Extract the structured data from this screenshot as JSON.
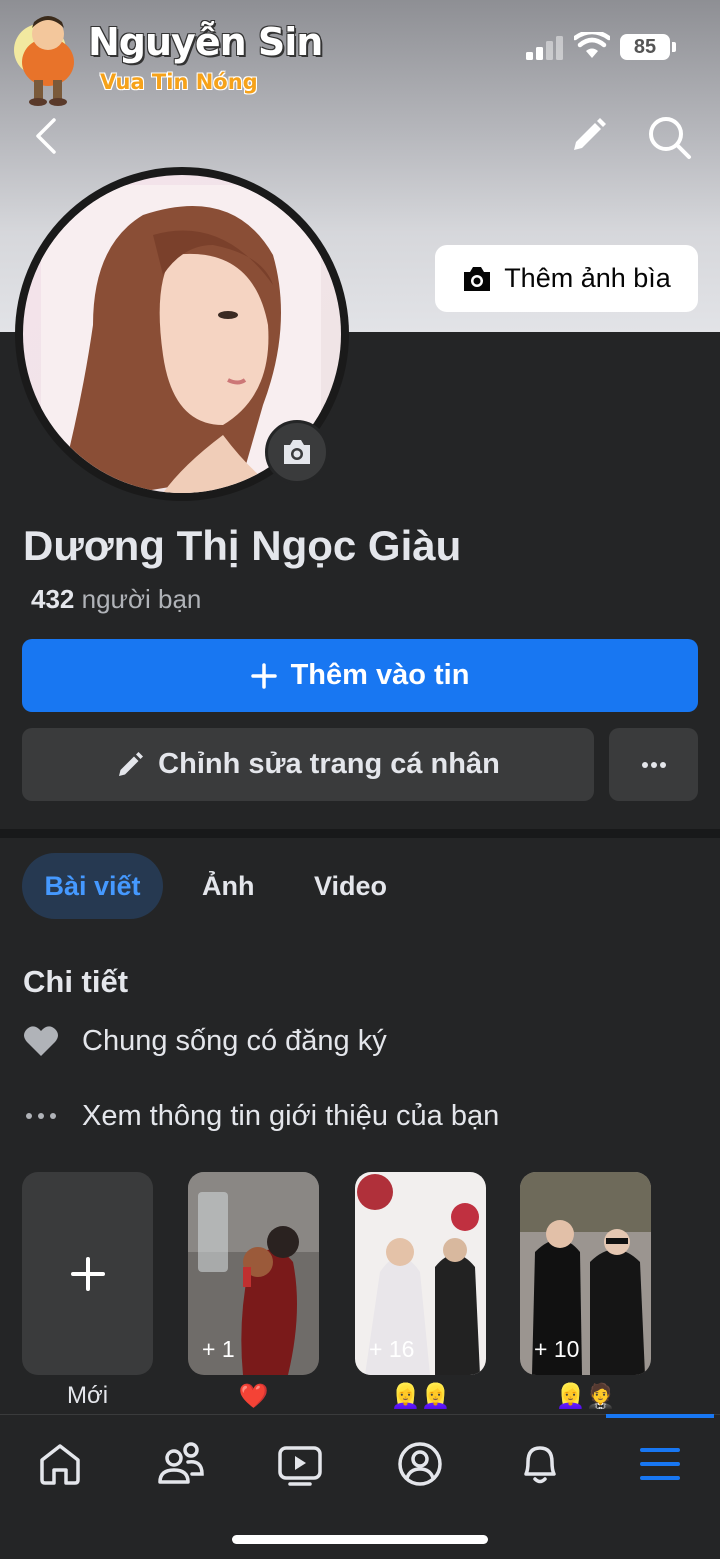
{
  "watermark": {
    "title": "Nguyễn Sin",
    "subtitle": "Vua Tin Nóng"
  },
  "status_bar": {
    "battery": "85"
  },
  "header": {
    "back_icon": "chevron-left-icon",
    "edit_icon": "pencil-icon",
    "search_icon": "search-icon",
    "add_cover_label": "Thêm ảnh bìa"
  },
  "profile": {
    "name": "Dương Thị Ngọc Giàu",
    "friends_count": "432",
    "friends_label": "người bạn"
  },
  "actions": {
    "add_story_label": "Thêm vào tin",
    "edit_profile_label": "Chỉnh sửa trang cá nhân"
  },
  "tabs": [
    {
      "label": "Bài viết",
      "active": true
    },
    {
      "label": "Ảnh",
      "active": false
    },
    {
      "label": "Video",
      "active": false
    }
  ],
  "details": {
    "title": "Chi tiết",
    "relationship": "Chung sống có đăng ký",
    "intro": "Xem thông tin giới thiệu của bạn"
  },
  "featured": [
    {
      "label": "Mới",
      "count": ""
    },
    {
      "label": "❤️",
      "count": "+ 1"
    },
    {
      "label": "👱‍♀️👱‍♀️",
      "count": "+ 16"
    },
    {
      "label": "👱‍♀️🤵",
      "count": "+ 10"
    }
  ],
  "bottom_nav": [
    "home-icon",
    "friends-icon",
    "video-icon",
    "profile-icon",
    "bell-icon",
    "menu-icon"
  ],
  "colors": {
    "accent": "#1877f2",
    "background": "#242526",
    "button": "#3a3b3c"
  }
}
